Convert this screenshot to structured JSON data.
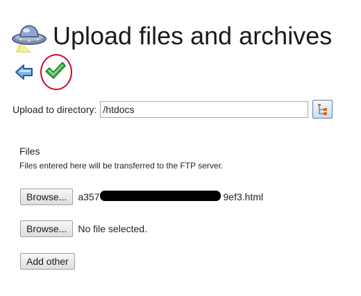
{
  "header": {
    "title": "Upload files and archives",
    "icon": "ufo-icon"
  },
  "toolbar": {
    "back_icon": "back-arrow-icon",
    "submit_icon": "green-checkmark-icon",
    "highlight_color": "#c8102e"
  },
  "directory": {
    "label": "Upload to directory:",
    "value": "/htdocs",
    "picker_icon": "directory-tree-icon"
  },
  "files": {
    "heading": "Files",
    "hint": "Files entered here will be transferred to the FTP server.",
    "rows": [
      {
        "browse_label": "Browse...",
        "filename": "a357",
        "filename_end": "9ef3.html",
        "redacted": true
      },
      {
        "browse_label": "Browse...",
        "filename": "No file selected."
      }
    ],
    "add_other_label": "Add other"
  }
}
